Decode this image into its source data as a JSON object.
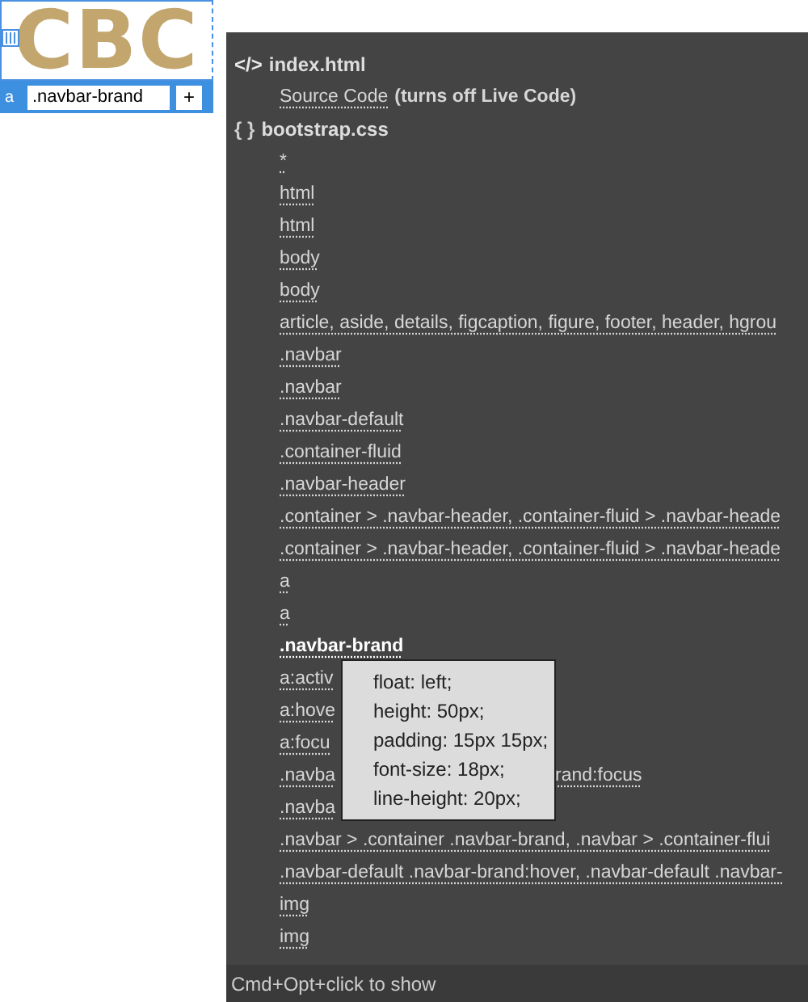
{
  "logo": {
    "text": "CBC"
  },
  "selection": {
    "tag": "a",
    "class_field": ".navbar-brand",
    "add_button": "+"
  },
  "files": [
    {
      "kind": "html",
      "icon": "</>",
      "name": "index.html",
      "children": [
        {
          "text": "Source Code",
          "note": "(turns off Live Code)",
          "highlighted": false
        }
      ]
    },
    {
      "kind": "css",
      "icon": "{ }",
      "name": "bootstrap.css",
      "children": [
        {
          "text": "*",
          "highlighted": false
        },
        {
          "text": "html",
          "highlighted": false
        },
        {
          "text": "html",
          "highlighted": false
        },
        {
          "text": "body",
          "highlighted": false
        },
        {
          "text": "body",
          "highlighted": false
        },
        {
          "text": "article, aside, details, figcaption, figure, footer, header, hgrou",
          "highlighted": false
        },
        {
          "text": ".navbar",
          "highlighted": false
        },
        {
          "text": ".navbar",
          "highlighted": false
        },
        {
          "text": ".navbar-default",
          "highlighted": false
        },
        {
          "text": ".container-fluid",
          "highlighted": false
        },
        {
          "text": ".navbar-header",
          "highlighted": false
        },
        {
          "text": ".container > .navbar-header, .container-fluid > .navbar-heade",
          "highlighted": false
        },
        {
          "text": ".container > .navbar-header, .container-fluid > .navbar-heade",
          "highlighted": false
        },
        {
          "text": "a",
          "highlighted": false
        },
        {
          "text": "a",
          "highlighted": false
        },
        {
          "text": ".navbar-brand",
          "highlighted": true
        },
        {
          "text": "a:activ",
          "highlighted": false
        },
        {
          "text": "a:hove",
          "highlighted": false
        },
        {
          "text": "a:focu",
          "highlighted": false
        },
        {
          "text": ".navba",
          "tail": "rand:focus",
          "highlighted": false
        },
        {
          "text": ".navba",
          "highlighted": false
        },
        {
          "text": ".navbar > .container .navbar-brand, .navbar > .container-flui",
          "highlighted": false
        },
        {
          "text": ".navbar-default .navbar-brand:hover, .navbar-default .navbar-",
          "highlighted": false
        },
        {
          "text": "img",
          "highlighted": false
        },
        {
          "text": "img",
          "highlighted": false
        }
      ]
    }
  ],
  "tooltip": {
    "lines": [
      "float: left;",
      "height: 50px;",
      "padding: 15px 15px;",
      "font-size: 18px;",
      "line-height: 20px;"
    ]
  },
  "status_bar": {
    "text": "Cmd+Opt+click to show"
  }
}
